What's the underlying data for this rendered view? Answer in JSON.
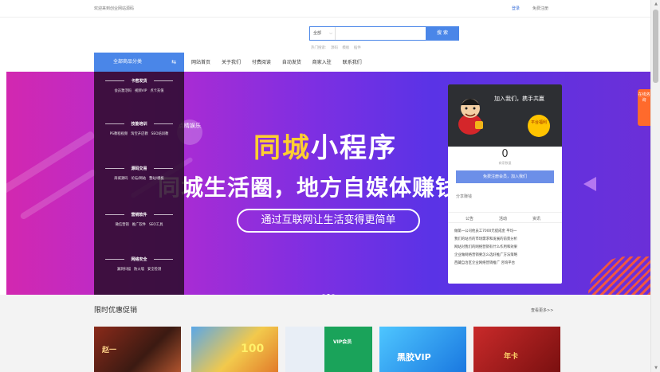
{
  "topbar": {
    "welcome": "欢迎来到创业网站源码",
    "login": "登录",
    "register": "免费注册"
  },
  "search": {
    "scope": "全部",
    "placeholder": "",
    "button": "搜 索",
    "hotwords": [
      "热门搜索:",
      "源码",
      "模板",
      "插件"
    ]
  },
  "nav": {
    "category_label": "全部商品分类",
    "links": [
      "网站首页",
      "关于我们",
      "付费阅读",
      "自动发货",
      "商家入驻",
      "联系我们"
    ]
  },
  "category_menu": [
    {
      "title": "卡密发货",
      "items": [
        "会员激活码",
        "视频VIP",
        "点卡充值"
      ]
    },
    {
      "title": "技能培训",
      "items": [
        "PS教程视频",
        "淘宝开店教",
        "SEO培训教"
      ]
    },
    {
      "title": "源码交易",
      "items": [
        "商城源码",
        "论坛/网站",
        "整站/模板"
      ]
    },
    {
      "title": "营销软件",
      "items": [
        "微信营销",
        "推广软件",
        "SEO工具"
      ]
    },
    {
      "title": "网络安全",
      "items": [
        "漏洞扫描",
        "防火墙",
        "安全检测"
      ]
    }
  ],
  "banner": {
    "circle_text": "点睛娱乐",
    "title_highlight": "同城",
    "title_rest": "小程序",
    "subtitle": "同城生活圈，地方自媒体赚钱",
    "pill": "通过互联网让生活变得更简单",
    "slide_count": 3,
    "active_slide": 1
  },
  "right_panel": {
    "title": "加入我们，携手共赢",
    "badge": "平台福利",
    "count": "0",
    "count_label": "商家数量",
    "join_button": "免费注册会员，加入我们",
    "share_label": "分享赚钱",
    "tabs": [
      "公告",
      "活动",
      "资讯"
    ],
    "news": [
      "做第一公司他员工7000元提成金 平均一",
      "我们的站点的市场需求和发展的前景分析",
      "网站对我们的网络营销有什么作用和效果",
      "企业做网络营销要怎么选好推广方法策略",
      "西藏自治区企业网络营销推广 咨询平台"
    ]
  },
  "side_badge": "在线咨询",
  "lower": {
    "section_title": "限时优惠促销",
    "more": "查看更多>>",
    "cards": [
      {
        "label": "赵一"
      },
      {
        "label": "100"
      },
      {
        "label": "VIP会员"
      },
      {
        "label": "黑胶VIP"
      },
      {
        "label": "年卡"
      }
    ]
  },
  "colors": {
    "accent": "#4a86e8",
    "banner_yellow": "#ffcf30",
    "panel_dark": "#2d2f33",
    "side_badge": "#ff6a2c"
  }
}
